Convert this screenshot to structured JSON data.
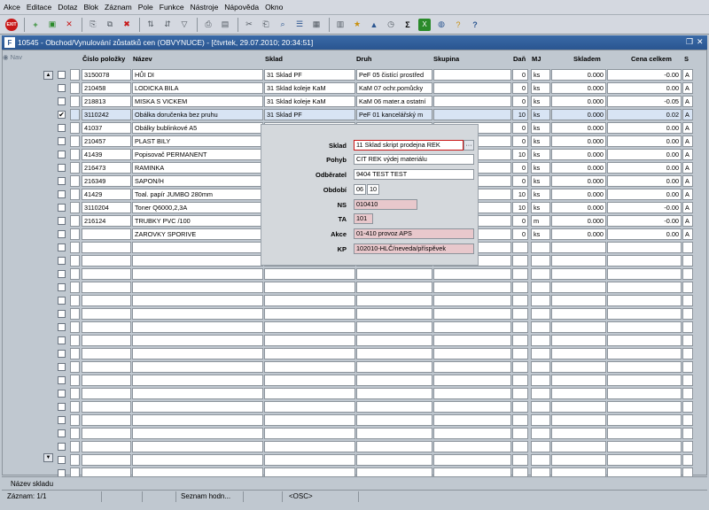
{
  "menu": [
    "Akce",
    "Editace",
    "Dotaz",
    "Blok",
    "Záznam",
    "Pole",
    "Funkce",
    "Nástroje",
    "Nápověda",
    "Okno"
  ],
  "window": {
    "title": "10545 - Obchod/Vynulování zůstatků cen (OBVYNUCE) - [čtvrtek, 29.07.2010; 20:34:51]"
  },
  "nav_label": "Nav",
  "columns": [
    "Číslo položky",
    "Název",
    "Sklad",
    "Druh",
    "Skupina",
    "Daň",
    "MJ",
    "Skladem",
    "Cena celkem",
    "S"
  ],
  "rows": [
    {
      "checked": false,
      "cislo": "3150078",
      "nazev": "HŮI DI",
      "sklad": "31 Sklad PF",
      "druh": "PeF 05 čistící prostřed",
      "skupina": "",
      "dan": "0",
      "mj": "ks",
      "skladem": "0.000",
      "cena": "-0.00",
      "s": "A"
    },
    {
      "checked": false,
      "cislo": "210458",
      "nazev": "LODICKA BILA",
      "sklad": "31 Sklad koleje KaM",
      "druh": "KaM 07 ochr.pomůcky",
      "skupina": "",
      "dan": "0",
      "mj": "ks",
      "skladem": "0.000",
      "cena": "0.00",
      "s": "A"
    },
    {
      "checked": false,
      "cislo": "218813",
      "nazev": "MISKA S VICKEM",
      "sklad": "31 Sklad koleje KaM",
      "druh": "KaM 06 mater.a ostatní",
      "skupina": "",
      "dan": "0",
      "mj": "ks",
      "skladem": "0.000",
      "cena": "-0.05",
      "s": "A"
    },
    {
      "checked": true,
      "cislo": "3110242",
      "nazev": "Obálka doručenka bez pruhu",
      "sklad": "31 Sklad PF",
      "druh": "PeF 01 kancelářský m",
      "skupina": "",
      "dan": "10",
      "mj": "ks",
      "skladem": "0.000",
      "cena": "0.02",
      "s": "A"
    },
    {
      "checked": false,
      "cislo": "41037",
      "nazev": "Obálky bublinkové A5",
      "sklad": "",
      "druh": "",
      "skupina": "",
      "dan": "0",
      "mj": "ks",
      "skladem": "0.000",
      "cena": "0.00",
      "s": "A"
    },
    {
      "checked": false,
      "cislo": "210457",
      "nazev": "PLAST BILY",
      "sklad": "",
      "druh": "",
      "skupina": "",
      "dan": "0",
      "mj": "ks",
      "skladem": "0.000",
      "cena": "0.00",
      "s": "A"
    },
    {
      "checked": false,
      "cislo": "41439",
      "nazev": "Popisovač PERMANENT",
      "sklad": "",
      "druh": "",
      "skupina": "",
      "dan": "10",
      "mj": "ks",
      "skladem": "0.000",
      "cena": "0.00",
      "s": "A"
    },
    {
      "checked": false,
      "cislo": "216473",
      "nazev": "RAMINKA",
      "sklad": "",
      "druh": "",
      "skupina": "",
      "dan": "0",
      "mj": "ks",
      "skladem": "0.000",
      "cena": "0.00",
      "s": "A"
    },
    {
      "checked": false,
      "cislo": "216349",
      "nazev": "SAPON/H",
      "sklad": "",
      "druh": "",
      "skupina": "",
      "dan": "0",
      "mj": "ks",
      "skladem": "0.000",
      "cena": "0.00",
      "s": "A"
    },
    {
      "checked": false,
      "cislo": "41429",
      "nazev": "Toal. papír JUMBO 280mm",
      "sklad": "",
      "druh": "",
      "skupina": "",
      "dan": "10",
      "mj": "ks",
      "skladem": "0.000",
      "cena": "0.00",
      "s": "A"
    },
    {
      "checked": false,
      "cislo": "3110204",
      "nazev": "Toner Q6000,2,3A",
      "sklad": "",
      "druh": "",
      "skupina": "",
      "dan": "10",
      "mj": "ks",
      "skladem": "0.000",
      "cena": "-0.00",
      "s": "A"
    },
    {
      "checked": false,
      "cislo": "216124",
      "nazev": "TRUBKY PVC /100",
      "sklad": "",
      "druh": "",
      "skupina": "",
      "dan": "0",
      "mj": "m",
      "skladem": "0.000",
      "cena": "-0.00",
      "s": "A"
    },
    {
      "checked": false,
      "cislo": "",
      "nazev": "ZAROVKY SPORIVE",
      "sklad": "",
      "druh": "",
      "skupina": "",
      "dan": "0",
      "mj": "ks",
      "skladem": "0.000",
      "cena": "0.00",
      "s": "A"
    }
  ],
  "empty_rows": 18,
  "popup": {
    "sklad_label": "Sklad",
    "sklad_value": "11 Sklad skript prodejna REK",
    "pohyb_label": "Pohyb",
    "pohyb_value": "CIT REK výdej materiálu",
    "odberatel_label": "Odběratel",
    "odberatel_value": "9404 TEST TEST",
    "obdobi_label": "Období",
    "obdobi_month": "06",
    "obdobi_year": "10",
    "ns_label": "NS",
    "ns_value": "010410",
    "ta_label": "TA",
    "ta_value": "101",
    "akce_label": "Akce",
    "akce_value": "01-410 provoz APS",
    "kp_label": "KP",
    "kp_value": "102010-HLČ/neveda/příspěvek"
  },
  "status": {
    "hint": "Název skladu",
    "record": "Záznam: 1/1",
    "list": "Seznam hodn...",
    "osc": "<OSC>"
  },
  "colors": {
    "title_bar": "#2a5590",
    "selected_row": "#d8e4f4",
    "readonly_field": "#e8c8cc"
  }
}
